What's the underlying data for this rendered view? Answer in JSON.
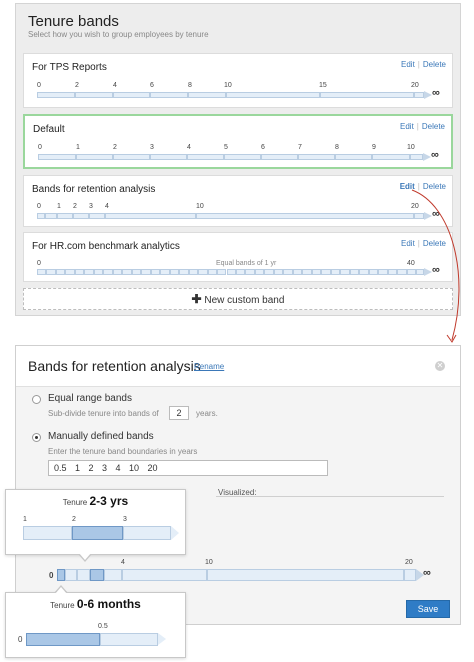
{
  "top": {
    "title": "Tenure bands",
    "subtitle": "Select how you wish to group employees by tenure",
    "edit_label": "Edit",
    "delete_label": "Delete",
    "cards": [
      {
        "title": "For TPS Reports",
        "ticks": [
          "0",
          "2",
          "4",
          "6",
          "8",
          "10",
          "15",
          "20"
        ]
      },
      {
        "title": "Default",
        "ticks": [
          "0",
          "1",
          "2",
          "3",
          "4",
          "5",
          "6",
          "7",
          "8",
          "9",
          "10"
        ]
      },
      {
        "title": "Bands for retention analysis",
        "ticks": [
          "0",
          "1",
          "2",
          "3",
          "4",
          "10",
          "20"
        ]
      },
      {
        "title": "For HR.com benchmark analytics",
        "ticks": [
          "0",
          "40"
        ],
        "center_label": "Equal bands of 1 yr"
      }
    ],
    "infinity": "∞",
    "new_band_label": "New custom band"
  },
  "dialog": {
    "title": "Bands for retention analysis",
    "rename": "Rename",
    "option1_label": "Equal range bands",
    "option1_hint_pre": "Sub-divide tenure into bands of",
    "option1_value": "2",
    "option1_hint_post": "years.",
    "option2_label": "Manually defined bands",
    "option2_hint": "Enter the tenure band boundaries in years",
    "boundaries": "0.5 1 2 3 4 10 20",
    "visualized_label": "Visualized:",
    "ticks": [
      "0",
      "4",
      "10",
      "20"
    ],
    "save_label": "Save"
  },
  "tooltip1": {
    "prefix": "Tenure",
    "value": "2-3 yrs",
    "ticks": [
      "1",
      "2",
      "3"
    ]
  },
  "tooltip2": {
    "prefix": "Tenure",
    "value": "0-6 months",
    "ticks": [
      "0",
      "0.5"
    ]
  },
  "colors": {
    "accent": "#2f7cc6",
    "selected_border": "#9ad79c",
    "connector": "#c0392b"
  }
}
